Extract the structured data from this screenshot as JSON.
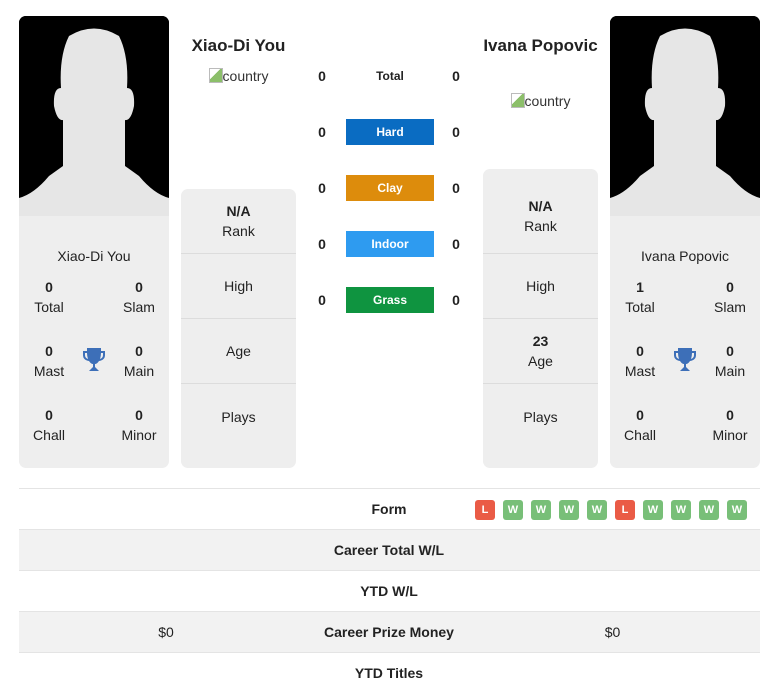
{
  "players": [
    {
      "name": "Xiao-Di You",
      "country_alt": "country",
      "card_name": "Xiao-Di You",
      "titles": {
        "total": {
          "value": "0",
          "label": "Total"
        },
        "slam": {
          "value": "0",
          "label": "Slam"
        },
        "mast": {
          "value": "0",
          "label": "Mast"
        },
        "main": {
          "value": "0",
          "label": "Main"
        },
        "chall": {
          "value": "0",
          "label": "Chall"
        },
        "minor": {
          "value": "0",
          "label": "Minor"
        }
      },
      "info": {
        "rank": {
          "value": "N/A",
          "label": "Rank"
        },
        "high": {
          "value": "",
          "label": "High"
        },
        "age": {
          "value": "",
          "label": "Age"
        },
        "plays": {
          "value": "",
          "label": "Plays"
        }
      }
    },
    {
      "name": "Ivana Popovic",
      "country_alt": "country",
      "card_name": "Ivana Popovic",
      "titles": {
        "total": {
          "value": "1",
          "label": "Total"
        },
        "slam": {
          "value": "0",
          "label": "Slam"
        },
        "mast": {
          "value": "0",
          "label": "Mast"
        },
        "main": {
          "value": "0",
          "label": "Main"
        },
        "chall": {
          "value": "0",
          "label": "Chall"
        },
        "minor": {
          "value": "0",
          "label": "Minor"
        }
      },
      "info": {
        "rank": {
          "value": "N/A",
          "label": "Rank"
        },
        "high": {
          "value": "",
          "label": "High"
        },
        "age": {
          "value": "23",
          "label": "Age"
        },
        "plays": {
          "value": "",
          "label": "Plays"
        }
      }
    }
  ],
  "h2h": [
    {
      "label": "Total",
      "left": "0",
      "right": "0",
      "color": ""
    },
    {
      "label": "Hard",
      "left": "0",
      "right": "0",
      "color": "#0a6cc2"
    },
    {
      "label": "Clay",
      "left": "0",
      "right": "0",
      "color": "#dd8c0c"
    },
    {
      "label": "Indoor",
      "left": "0",
      "right": "0",
      "color": "#2e9bf0"
    },
    {
      "label": "Grass",
      "left": "0",
      "right": "0",
      "color": "#0f9440"
    }
  ],
  "comparison": {
    "form_label": "Form",
    "form": [
      "L",
      "W",
      "W",
      "W",
      "W",
      "L",
      "W",
      "W",
      "W",
      "W"
    ],
    "rows": [
      {
        "label": "Career Total W/L",
        "left": "",
        "right": ""
      },
      {
        "label": "YTD W/L",
        "left": "",
        "right": ""
      },
      {
        "label": "Career Prize Money",
        "left": "$0",
        "right": "$0"
      },
      {
        "label": "YTD Titles",
        "left": "",
        "right": ""
      }
    ]
  },
  "colors": {
    "trophy": "#3d6fb8",
    "win": "#78bf78",
    "loss": "#ea5b46"
  }
}
